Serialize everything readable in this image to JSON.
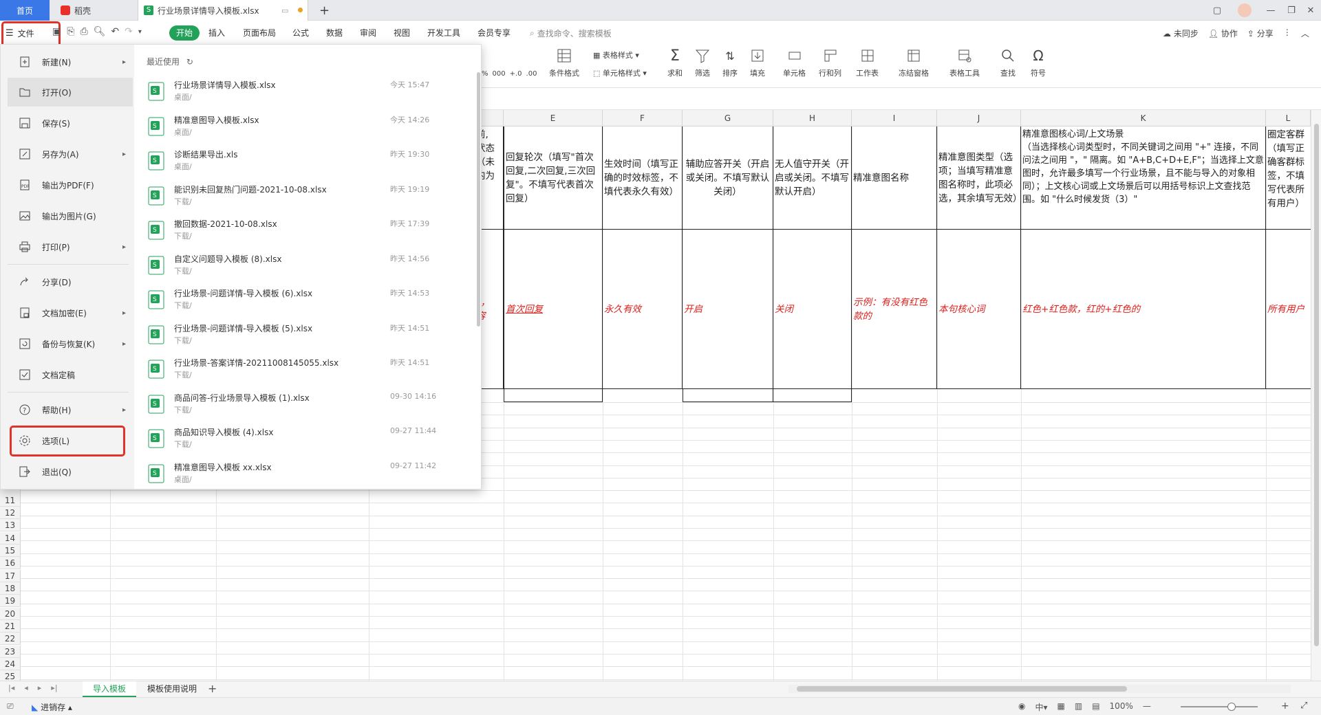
{
  "titlebar": {
    "home_tab": "首页",
    "daoke_tab": "稻壳",
    "file_tab": "行业场景详情导入模板.xlsx",
    "new_tab": "+"
  },
  "menubar": {
    "file_menu": "文件",
    "tabs": [
      "开始",
      "插入",
      "页面布局",
      "公式",
      "数据",
      "审阅",
      "视图",
      "开发工具",
      "会员专享"
    ],
    "search_placeholder": "查找命令、搜索模板",
    "right": {
      "sync": "未同步",
      "collab": "协作",
      "share": "分享"
    }
  },
  "ribbon": {
    "table_style": "表格样式",
    "cell_style": "单元格样式",
    "cond_format": "条件格式",
    "number_labels": {
      "thousands": "000",
      "inc": "+.0",
      "dec": ".00"
    },
    "buttons": [
      "求和",
      "筛选",
      "排序",
      "填充",
      "单元格",
      "行和列",
      "工作表",
      "冻结窗格",
      "表格工具",
      "查找",
      "符号"
    ]
  },
  "file_menu": {
    "items": [
      {
        "label": "新建(N)",
        "arrow": true
      },
      {
        "label": "打开(O)",
        "arrow": false
      },
      {
        "label": "保存(S)",
        "arrow": false
      },
      {
        "label": "另存为(A)",
        "arrow": true
      },
      {
        "label": "输出为PDF(F)",
        "arrow": false
      },
      {
        "label": "输出为图片(G)",
        "arrow": false
      },
      {
        "label": "打印(P)",
        "arrow": true
      },
      {
        "label": "分享(D)",
        "arrow": false
      },
      {
        "label": "文档加密(E)",
        "arrow": true
      },
      {
        "label": "备份与恢复(K)",
        "arrow": true
      },
      {
        "label": "文档定稿",
        "arrow": false
      },
      {
        "label": "帮助(H)",
        "arrow": true
      },
      {
        "label": "选项(L)",
        "arrow": false
      },
      {
        "label": "退出(Q)",
        "arrow": false
      }
    ],
    "recent_title": "最近使用",
    "recent": [
      {
        "name": "行业场景详情导入模板.xlsx",
        "path": "桌面/",
        "time": "今天 15:47"
      },
      {
        "name": "精准意图导入模板.xlsx",
        "path": "桌面/",
        "time": "今天 14:26"
      },
      {
        "name": "诊断结果导出.xls",
        "path": "桌面/",
        "time": "昨天 19:30"
      },
      {
        "name": "能识别未回复热门问题-2021-10-08.xlsx",
        "path": "下载/",
        "time": "昨天 19:19"
      },
      {
        "name": "撤回数据-2021-10-08.xlsx",
        "path": "下载/",
        "time": "昨天 17:39"
      },
      {
        "name": "自定义问题导入模板 (8).xlsx",
        "path": "下载/",
        "time": "昨天 14:56"
      },
      {
        "name": "行业场景-问题详情-导入模板 (6).xlsx",
        "path": "下载/",
        "time": "昨天 14:53"
      },
      {
        "name": "行业场景-问题详情-导入模板 (5).xlsx",
        "path": "下载/",
        "time": "昨天 14:51"
      },
      {
        "name": "行业场景-答案详情-20211008145055.xlsx",
        "path": "下载/",
        "time": "昨天 14:51"
      },
      {
        "name": "商品问答-行业场景导入模板 (1).xlsx",
        "path": "下载/",
        "time": "09-30 14:16"
      },
      {
        "name": "商品知识导入模板 (4).xlsx",
        "path": "下载/",
        "time": "09-27 11:44"
      },
      {
        "name": "精准意图导入模板 xx.xlsx",
        "path": "桌面/",
        "time": "09-27 11:42"
      }
    ]
  },
  "sheet": {
    "columns": [
      "E",
      "F",
      "G",
      "H",
      "I",
      "J",
      "K",
      "L"
    ],
    "rows": [
      "11",
      "12",
      "13",
      "14",
      "15",
      "16",
      "17",
      "18",
      "19",
      "20",
      "21",
      "22",
      "23",
      "24",
      "25"
    ],
    "partial_header_text": "前,\n状态\n（未\n内为\n）",
    "partial_example_text": "），\n容",
    "headers": {
      "E": "回复轮次（填写\"首次回复,二次回复,三次回复\"。不填写代表首次回复）",
      "F": "生效时间（填写正确的时效标签，不填代表永久有效）",
      "G": "辅助应答开关（开启或关闭。不填写默认关闭）",
      "H": "无人值守开关（开启或关闭。不填写默认开启）",
      "I": "精准意图名称",
      "J": "精准意图类型（选项；当填写精准意图名称时，此项必选，其余填写无效）",
      "K": "精准意图核心词/上文场景\n（当选择核心词类型时，不同关键词之间用 \"+\" 连接，不同问法之间用 \"，\" 隔离。如 \"A+B,C+D+E,F\"；当选择上文意图时，允许最多填写一个行业场景，且不能与导入的对象相同）；上文核心词或上文场景后可以用括号标识上文查找范围。如 \"什么时候发货（3）\"",
      "L": "圈定客群（填写正确客群标签，不填写代表所有用户）"
    },
    "examples": {
      "E": "首次回复",
      "F": "永久有效",
      "G": "开启",
      "H": "关闭",
      "I": "示例：有没有红色款的",
      "J": "本句核心词",
      "K": "红色+红色款，红的+红色的",
      "L": "所有用户"
    }
  },
  "sheet_tabs": [
    "导入模板",
    "模板使用说明"
  ],
  "statusbar": {
    "left": "进销存",
    "zoom": "100%"
  },
  "colors": {
    "accent": "#23a25a",
    "highlight": "#e0322b",
    "example_red": "#e0201d"
  }
}
